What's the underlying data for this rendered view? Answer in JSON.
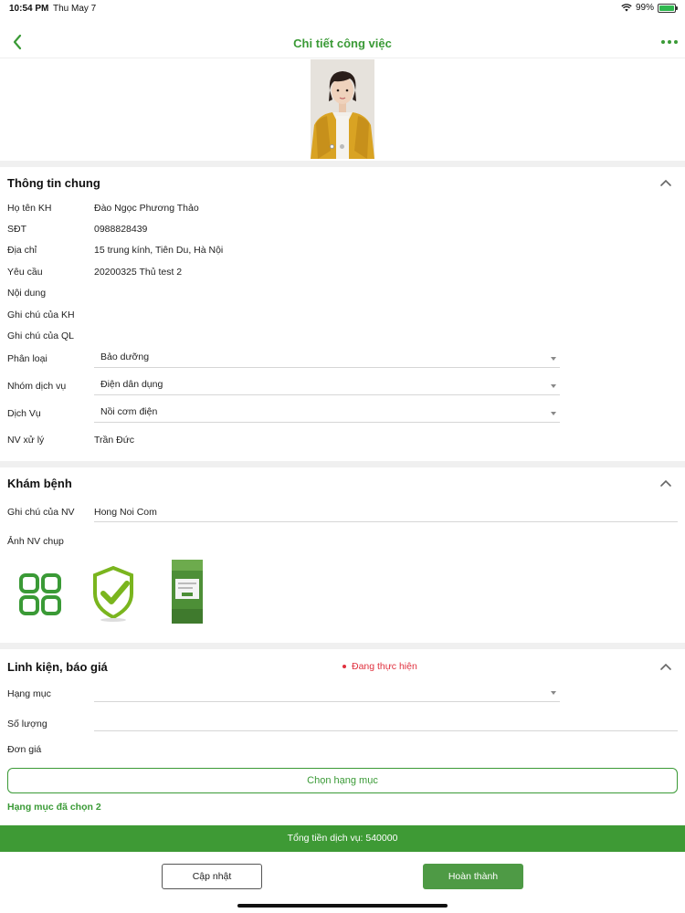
{
  "status_bar": {
    "time": "10:54 PM",
    "date": "Thu May 7",
    "battery": "99%"
  },
  "nav": {
    "title": "Chi tiết công việc"
  },
  "general": {
    "title": "Thông tin chung",
    "customer_name_label": "Họ tên KH",
    "customer_name": "Đào Ngọc Phương Thảo",
    "phone_label": "SĐT",
    "phone": "0988828439",
    "address_label": "Địa chỉ",
    "address": "15 trung kính, Tiên Du, Hà Nội",
    "request_label": "Yêu cầu",
    "request": "20200325 Thủ test 2",
    "content_label": "Nội dung",
    "customer_note_label": "Ghi chú của KH",
    "manager_note_label": "Ghi chú của QL",
    "category_label": "Phân loại",
    "category_value": "Bảo dưỡng",
    "service_group_label": "Nhóm dịch vụ",
    "service_group_value": "Điện dân dụng",
    "service_label": "Dịch Vụ",
    "service_value": "Nồi cơm điện",
    "staff_label": "NV xử lý",
    "staff": "Trần Đức"
  },
  "diagnosis": {
    "title": "Khám bệnh",
    "staff_note_label": "Ghi chú của NV",
    "staff_note": "Hong Noi Com",
    "photos_label": "Ảnh NV chụp"
  },
  "parts": {
    "title": "Linh kiện, báo giá",
    "status": "Đang thực hiện",
    "item_label": "Hạng mục",
    "quantity_label": "Số lượng",
    "unit_price_label": "Đơn giá",
    "choose_button": "Chọn hạng mục",
    "chosen_text": "Hạng mục đã chọn 2"
  },
  "total": {
    "text": "Tổng tiền dịch vụ: 540000"
  },
  "actions": {
    "update": "Cập nhật",
    "complete": "Hoàn thành"
  },
  "colors": {
    "accent": "#3a9a36",
    "status_red": "#e0313f",
    "total_bar": "#3e9a35"
  }
}
